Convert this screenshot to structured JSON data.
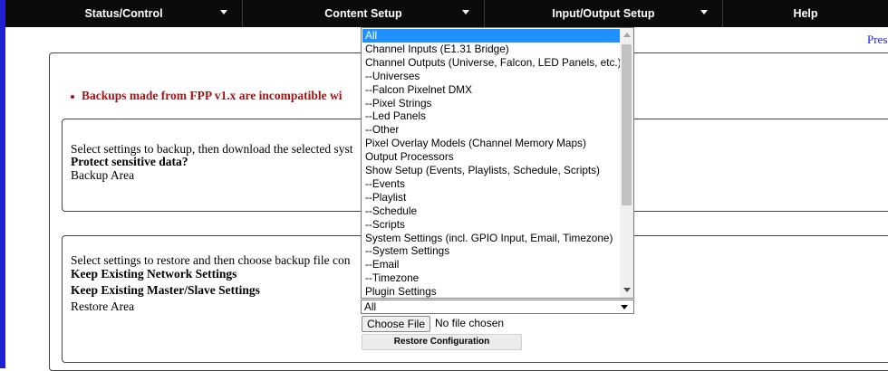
{
  "colors": {
    "nav_bg": "#0b0b0b",
    "accent_blue": "#2020d0",
    "warning_red": "#a31515",
    "highlight": "#1e90ff"
  },
  "nav": {
    "items": [
      {
        "label": "Status/Control"
      },
      {
        "label": "Content Setup"
      },
      {
        "label": "Input/Output Setup"
      },
      {
        "label": "Help"
      }
    ]
  },
  "header": {
    "pres_link": "Pres"
  },
  "warning_text": "Backups made from FPP v1.x are incompatible wi",
  "backup": {
    "intro": "Select settings to backup, then download the selected syst",
    "protect_label": "Protect sensitive data?",
    "area_label": "Backup Area"
  },
  "restore": {
    "intro": "Select settings to restore and then choose backup file con",
    "keep_network": "Keep Existing Network Settings",
    "keep_master": "Keep Existing Master/Slave Settings",
    "area_label": "Restore Area",
    "select_value": "All",
    "choose_file": "Choose File",
    "file_status": "No file chosen",
    "restore_button": "Restore Configuration"
  },
  "dropdown": {
    "options": [
      "All",
      "Channel Inputs (E1.31 Bridge)",
      "Channel Outputs (Universe, Falcon, LED Panels, etc.)",
      "--Universes",
      "--Falcon Pixelnet DMX",
      "--Pixel Strings",
      "--Led Panels",
      "--Other",
      "Pixel Overlay Models (Channel Memory Maps)",
      "Output Processors",
      "Show Setup (Events, Playlists, Schedule, Scripts)",
      "--Events",
      "--Playlist",
      "--Schedule",
      "--Scripts",
      "System Settings (incl. GPIO Input, Email, Timezone)",
      "--System Settings",
      "--Email",
      "--Timezone",
      "Plugin Settings"
    ],
    "selected_index": 0
  }
}
